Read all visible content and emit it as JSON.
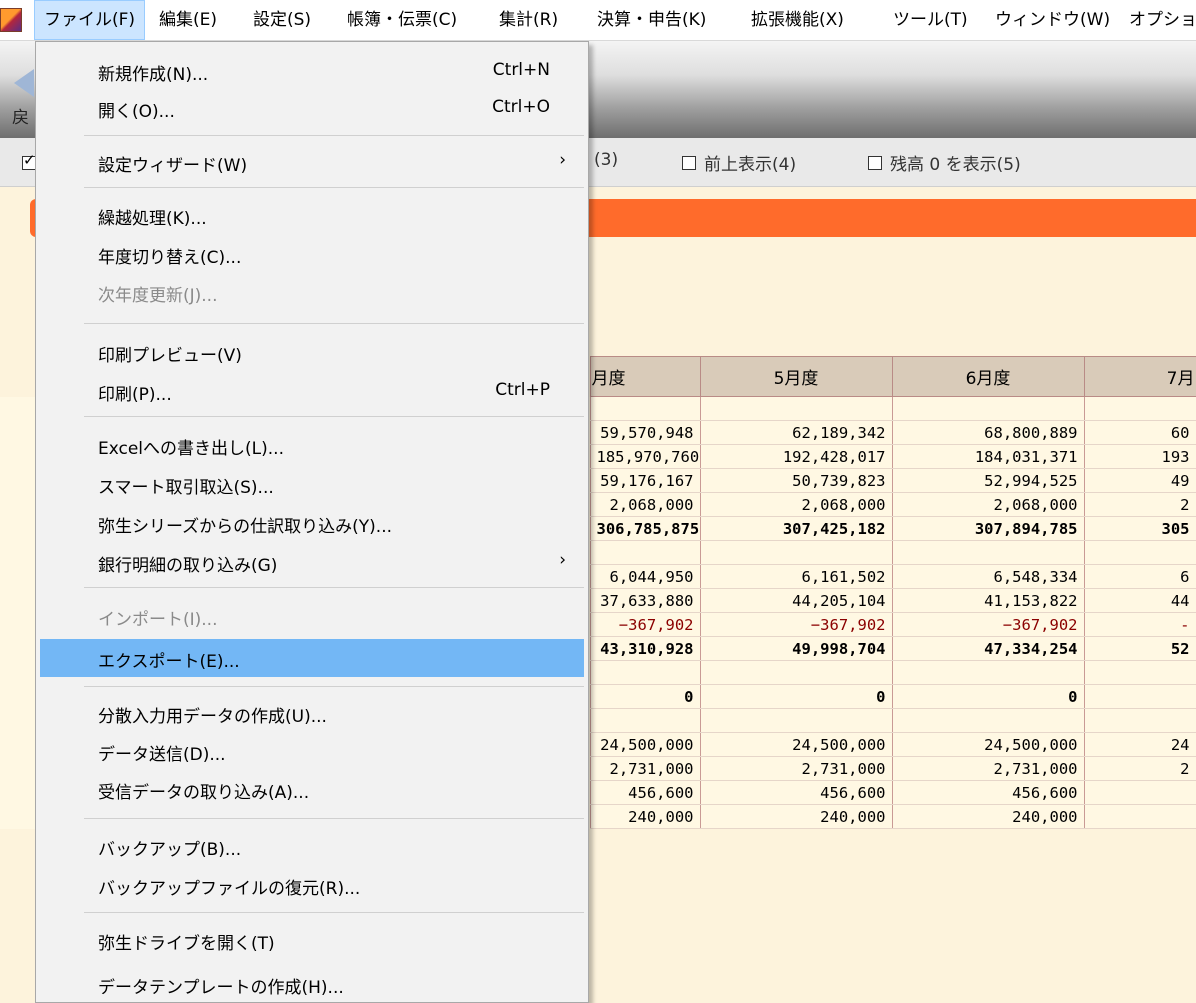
{
  "menubar": {
    "items": [
      {
        "label": "ファイル(F)"
      },
      {
        "label": "編集(E)"
      },
      {
        "label": "設定(S)"
      },
      {
        "label": "帳簿・伝票(C)"
      },
      {
        "label": "集計(R)"
      },
      {
        "label": "決算・申告(K)"
      },
      {
        "label": "拡張機能(X)"
      },
      {
        "label": "ツール(T)"
      },
      {
        "label": "ウィンドウ(W)"
      },
      {
        "label": "オプション"
      }
    ]
  },
  "toolbar": {
    "back_label": "戻"
  },
  "options": {
    "item3_fragment": "(3)",
    "item4_label": "前上表示(4)",
    "item5_label": "残高 0 を表示(5)"
  },
  "file_menu": {
    "items": [
      {
        "label": "新規作成(N)...",
        "shortcut": "Ctrl+N"
      },
      {
        "label": "開く(O)...",
        "shortcut": "Ctrl+O"
      },
      {
        "label": "設定ウィザード(W)",
        "submenu": "›"
      },
      {
        "label": "繰越処理(K)..."
      },
      {
        "label": "年度切り替え(C)..."
      },
      {
        "label": "次年度更新(J)...",
        "disabled": true
      },
      {
        "label": "印刷プレビュー(V)"
      },
      {
        "label": "印刷(P)...",
        "shortcut": "Ctrl+P"
      },
      {
        "label": "Excelへの書き出し(L)..."
      },
      {
        "label": "スマート取引取込(S)..."
      },
      {
        "label": "弥生シリーズからの仕訳取り込み(Y)..."
      },
      {
        "label": "銀行明細の取り込み(G)",
        "submenu": "›"
      },
      {
        "label": "インポート(I)...",
        "disabled": true
      },
      {
        "label": "エクスポート(E)..."
      },
      {
        "label": "分散入力用データの作成(U)..."
      },
      {
        "label": "データ送信(D)..."
      },
      {
        "label": "受信データの取り込み(A)..."
      },
      {
        "label": "バックアップ(B)..."
      },
      {
        "label": "バックアップファイルの復元(R)..."
      },
      {
        "label": "弥生ドライブを開く(T)"
      },
      {
        "label": "データテンプレートの作成(H)..."
      }
    ]
  },
  "table": {
    "headers": [
      "月度",
      "5月度",
      "6月度",
      "7月"
    ],
    "rows": [
      [
        "",
        "",
        "",
        ""
      ],
      [
        "59,570,948",
        "62,189,342",
        "68,800,889",
        "60"
      ],
      [
        "185,970,760",
        "192,428,017",
        "184,031,371",
        "193"
      ],
      [
        "59,176,167",
        "50,739,823",
        "52,994,525",
        "49"
      ],
      [
        "2,068,000",
        "2,068,000",
        "2,068,000",
        "2"
      ],
      [
        "306,785,875",
        "307,425,182",
        "307,894,785",
        "305"
      ],
      [
        "",
        "",
        "",
        ""
      ],
      [
        "6,044,950",
        "6,161,502",
        "6,548,334",
        "6"
      ],
      [
        "37,633,880",
        "44,205,104",
        "41,153,822",
        "44"
      ],
      [
        "−367,902",
        "−367,902",
        "−367,902",
        "-"
      ],
      [
        "43,310,928",
        "49,998,704",
        "47,334,254",
        "52"
      ],
      [
        "",
        "",
        "",
        ""
      ],
      [
        "0",
        "0",
        "0",
        ""
      ],
      [
        "",
        "",
        "",
        ""
      ],
      [
        "24,500,000",
        "24,500,000",
        "24,500,000",
        "24"
      ],
      [
        "2,731,000",
        "2,731,000",
        "2,731,000",
        "2"
      ],
      [
        "456,600",
        "456,600",
        "456,600",
        ""
      ],
      [
        "240,000",
        "240,000",
        "240,000",
        ""
      ]
    ],
    "bold_rows": [
      5,
      10,
      12
    ],
    "negative_rows": [
      9
    ]
  },
  "colors": {
    "accent_orange": "#ff6b2b",
    "menu_highlight": "#73b7f5",
    "negative": "#8b0000"
  }
}
